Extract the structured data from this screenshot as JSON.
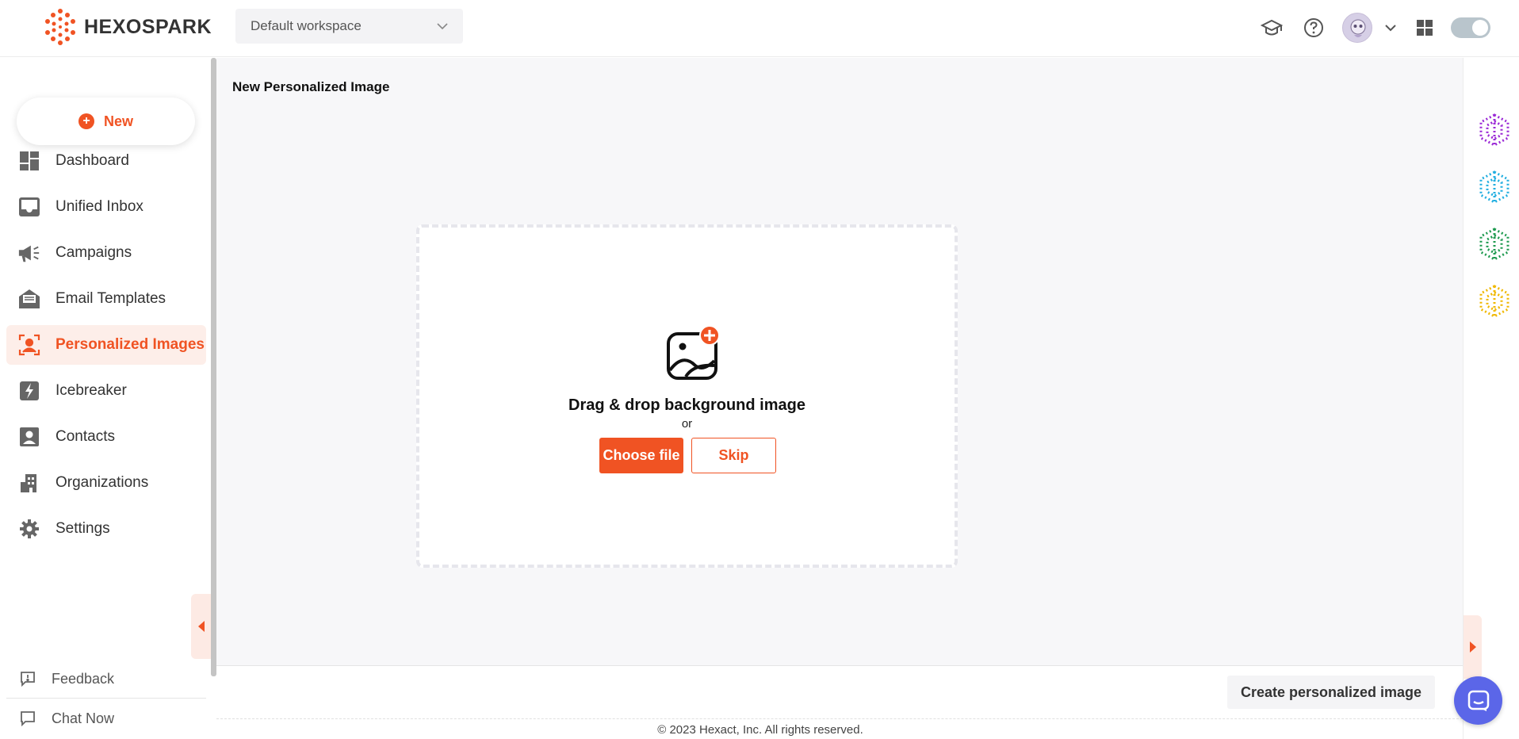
{
  "header": {
    "logo_text": "HEXOSPARK",
    "workspace": "Default workspace"
  },
  "sidebar": {
    "new_label": "New",
    "items": [
      {
        "label": "Dashboard",
        "icon": "dashboard-icon"
      },
      {
        "label": "Unified Inbox",
        "icon": "inbox-icon"
      },
      {
        "label": "Campaigns",
        "icon": "megaphone-icon"
      },
      {
        "label": "Email Templates",
        "icon": "email-template-icon"
      },
      {
        "label": "Personalized Images",
        "icon": "personalized-image-icon",
        "active": true
      },
      {
        "label": "Icebreaker",
        "icon": "lightning-icon"
      },
      {
        "label": "Contacts",
        "icon": "contact-icon"
      },
      {
        "label": "Organizations",
        "icon": "building-icon"
      },
      {
        "label": "Settings",
        "icon": "gear-icon"
      }
    ],
    "feedback": "Feedback",
    "chat_now": "Chat Now"
  },
  "main": {
    "title": "New Personalized Image",
    "dropzone": {
      "heading": "Drag & drop background image",
      "or": "or",
      "choose_file": "Choose file",
      "skip": "Skip"
    },
    "create_button": "Create personalized image",
    "copyright": "© 2023 Hexact, Inc. All rights reserved."
  },
  "colors": {
    "accent": "#f05323",
    "rail_logos": [
      "#9b2ad6",
      "#21aee0",
      "#1e9a4f",
      "#f0b800"
    ],
    "chat_fab": "#5b66e8"
  }
}
